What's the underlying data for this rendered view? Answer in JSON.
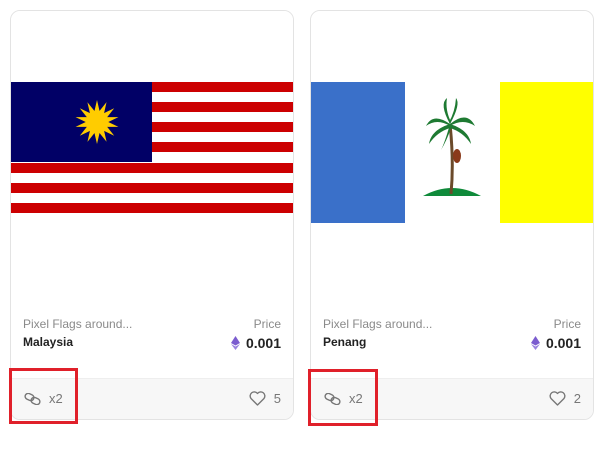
{
  "cards": [
    {
      "collection": "Pixel Flags around...",
      "name": "Malaysia",
      "price_label": "Price",
      "price": "0.001",
      "chain_count": "x2",
      "likes": "5"
    },
    {
      "collection": "Pixel Flags around...",
      "name": "Penang",
      "price_label": "Price",
      "price": "0.001",
      "chain_count": "x2",
      "likes": "2"
    }
  ],
  "colors": {
    "highlight": "#e0202a",
    "eth": "#7b5ccf",
    "malaysia_blue": "#010066",
    "malaysia_red": "#cc0001",
    "malaysia_yellow": "#ffcc00",
    "penang_blue": "#3a70c9",
    "penang_yellow": "#ffff00"
  },
  "icons": {
    "chain": "link-chain-icon",
    "likes": "heart-icon",
    "price": "ethereum-icon"
  }
}
